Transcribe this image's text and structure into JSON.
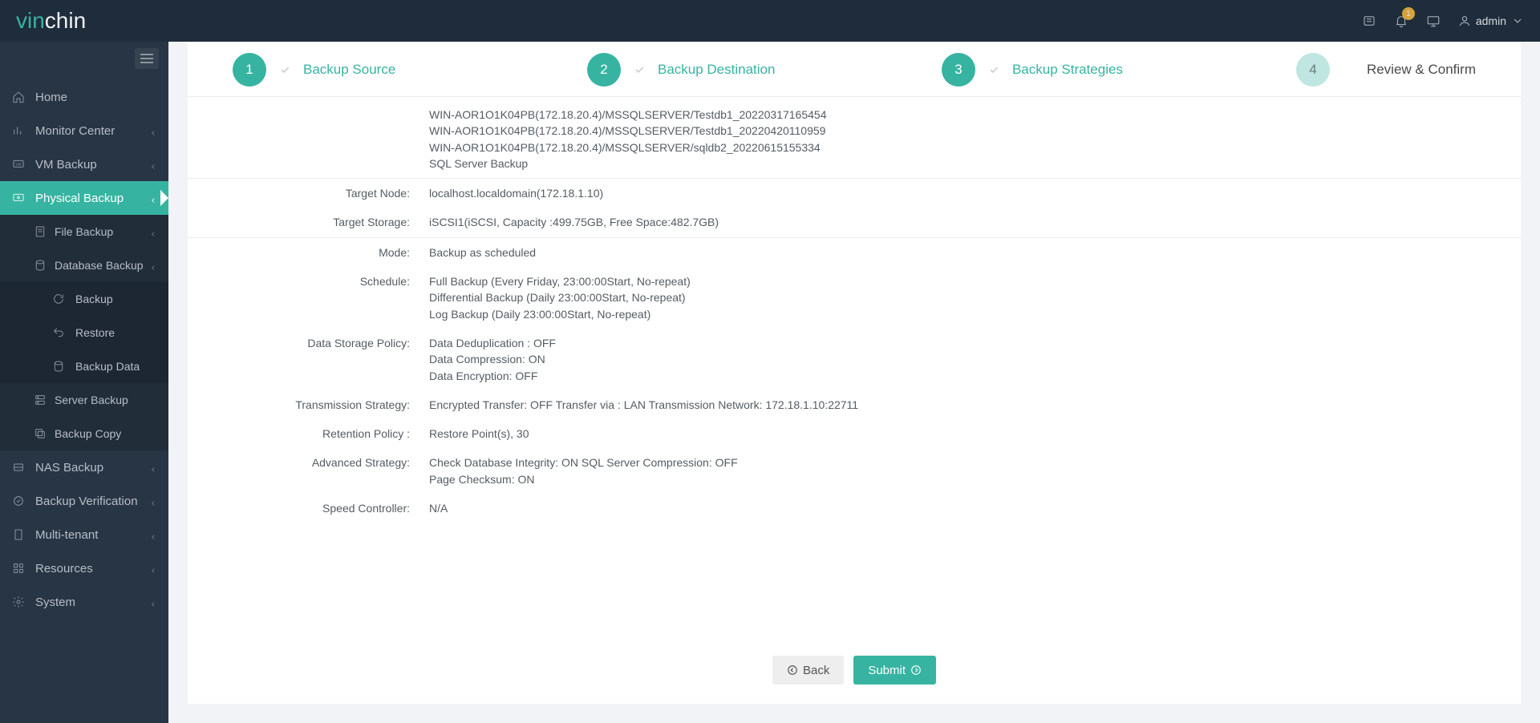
{
  "brand": {
    "left": "vin",
    "right": "chin"
  },
  "topbar": {
    "badge": "1",
    "user": "admin"
  },
  "sidebar": {
    "items": [
      {
        "label": "Home",
        "icon": "home",
        "kind": "section"
      },
      {
        "label": "Monitor Center",
        "icon": "chart",
        "kind": "section",
        "caret": true
      },
      {
        "label": "VM Backup",
        "icon": "vm",
        "kind": "section",
        "caret": true
      },
      {
        "label": "Physical Backup",
        "icon": "physical",
        "kind": "section",
        "caret": true,
        "active": true
      },
      {
        "label": "File Backup",
        "icon": "file",
        "kind": "sub",
        "caret": true
      },
      {
        "label": "Database Backup",
        "icon": "db",
        "kind": "sub",
        "caret": true
      },
      {
        "label": "Backup",
        "icon": "refresh",
        "kind": "subsub"
      },
      {
        "label": "Restore",
        "icon": "undo",
        "kind": "subsub"
      },
      {
        "label": "Backup Data",
        "icon": "db",
        "kind": "subsub"
      },
      {
        "label": "Server Backup",
        "icon": "server",
        "kind": "sub"
      },
      {
        "label": "Backup Copy",
        "icon": "copy",
        "kind": "sub"
      },
      {
        "label": "NAS Backup",
        "icon": "nas",
        "kind": "section",
        "caret": true
      },
      {
        "label": "Backup Verification",
        "icon": "verify",
        "kind": "section",
        "caret": true
      },
      {
        "label": "Multi-tenant",
        "icon": "building",
        "kind": "section",
        "caret": true
      },
      {
        "label": "Resources",
        "icon": "grid",
        "kind": "section",
        "caret": true
      },
      {
        "label": "System",
        "icon": "gear",
        "kind": "section",
        "caret": true
      }
    ]
  },
  "wizard": {
    "steps": [
      {
        "num": "1",
        "label": "Backup Source",
        "done": true
      },
      {
        "num": "2",
        "label": "Backup Destination",
        "done": true
      },
      {
        "num": "3",
        "label": "Backup Strategies",
        "done": true
      },
      {
        "num": "4",
        "label": "Review & Confirm",
        "current": true
      }
    ]
  },
  "review": {
    "source_overflow": [
      "WIN-AOR1O1K04PB(172.18.20.4)/MSSQLSERVER/Testdb1_20220317165454",
      "WIN-AOR1O1K04PB(172.18.20.4)/MSSQLSERVER/Testdb1_20220420110959",
      "WIN-AOR1O1K04PB(172.18.20.4)/MSSQLSERVER/sqldb2_20220615155334",
      "SQL Server Backup"
    ],
    "rows": [
      {
        "key": "Target Node:",
        "val": "localhost.localdomain(172.18.1.10)"
      },
      {
        "key": "Target Storage:",
        "val": "iSCSI1(iSCSI, Capacity :499.75GB, Free Space:482.7GB)"
      }
    ],
    "rows2": [
      {
        "key": "Mode:",
        "val": "Backup as scheduled"
      },
      {
        "key": "Schedule:",
        "lines": [
          "Full Backup (Every Friday, 23:00:00Start, No-repeat)",
          "Differential Backup (Daily 23:00:00Start, No-repeat)",
          "Log Backup (Daily 23:00:00Start, No-repeat)"
        ]
      },
      {
        "key": "Data Storage Policy:",
        "lines": [
          "Data Deduplication : OFF",
          "Data Compression: ON",
          "Data Encryption: OFF"
        ]
      },
      {
        "key": "Transmission Strategy:",
        "lines": [
          "Encrypted Transfer: OFF Transfer via : LAN Transmission Network: 172.18.1.10:22711"
        ]
      },
      {
        "key": "Retention Policy :",
        "val": "Restore Point(s), 30"
      },
      {
        "key": "Advanced Strategy:",
        "lines": [
          "Check Database Integrity: ON SQL Server Compression: OFF",
          "Page Checksum: ON"
        ]
      },
      {
        "key": "Speed Controller:",
        "val": "N/A"
      }
    ]
  },
  "buttons": {
    "back": "Back",
    "submit": "Submit"
  }
}
